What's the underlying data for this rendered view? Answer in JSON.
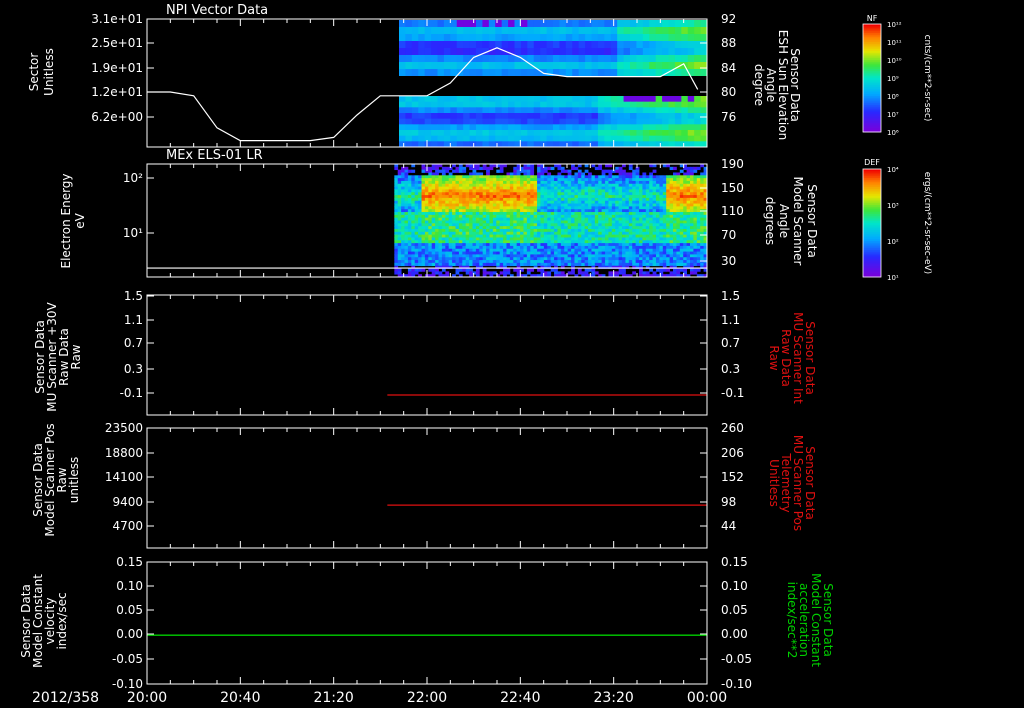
{
  "colors": {
    "background": "#000000",
    "axis": "#ffffff",
    "red_series": "#e01010",
    "green_series": "#00d000"
  },
  "header_panel_title": "NPI Vector Data",
  "footer": {
    "date": "2012/358"
  },
  "x_axis": {
    "ticks": [
      "20:00",
      "20:40",
      "21:20",
      "22:00",
      "22:40",
      "23:20",
      "00:00"
    ]
  },
  "colorbars": [
    {
      "title": "NF",
      "unit": "cnts/(cm**2-sr-sec)",
      "top_label": "10¹²",
      "bottom_label": "10⁶",
      "tick_labels": [
        "10¹²",
        "10¹¹",
        "10¹⁰",
        "10⁹",
        "10⁸",
        "10⁷",
        "10⁶"
      ]
    },
    {
      "title": "DEF",
      "unit": "ergs/(cm**2-sr-sec-eV)",
      "top_label": "10⁴",
      "bottom_label": "10¹",
      "tick_labels": [
        "10⁴",
        "10³",
        "10²",
        "10¹"
      ]
    }
  ],
  "chart_data": [
    {
      "type": "heatmap",
      "title": "NPI Vector Data",
      "ylabel": [
        "Sector",
        "Unitless"
      ],
      "ytick_labels": [
        "3.1e+01",
        "2.5e+01",
        "1.9e+01",
        "1.2e+01",
        "6.2e+00"
      ],
      "y2label": [
        "Sensor Data",
        "ESH Sun Elevation",
        "Angle",
        "degree"
      ],
      "y2tick_labels": [
        "92",
        "88",
        "84",
        "80",
        "76"
      ],
      "heatmap_start_time": "21:48",
      "line": {
        "y2lim": [
          72,
          92
        ],
        "x": [
          "20:00",
          "20:10",
          "20:20",
          "20:30",
          "20:40",
          "20:50",
          "21:00",
          "21:10",
          "21:20",
          "21:30",
          "21:40",
          "21:50",
          "22:00",
          "22:10",
          "22:20",
          "22:30",
          "22:40",
          "22:50",
          "23:00",
          "23:10",
          "23:20",
          "23:30",
          "23:40",
          "23:50",
          "23:56"
        ],
        "values": [
          80.6,
          80.6,
          80.0,
          75.0,
          73.0,
          73.0,
          73.0,
          73.0,
          73.5,
          77.0,
          80.0,
          80.0,
          80.0,
          82.0,
          86.0,
          87.5,
          86.0,
          83.5,
          83.0,
          83.0,
          83.0,
          83.0,
          83.0,
          85.0,
          81.0
        ]
      }
    },
    {
      "type": "heatmap",
      "title": "MEx ELS-01 LR",
      "ylabel": [
        "Electron Energy",
        "eV"
      ],
      "ytick_labels": [
        "10²",
        "10¹"
      ],
      "y2label": [
        "Sensor Data",
        "Model Scanner",
        "Angle",
        "degrees"
      ],
      "y2tick_labels": [
        "190",
        "150",
        "110",
        "70",
        "30"
      ],
      "heatmap_start_time": "21:46",
      "line": {
        "y2lim": [
          0,
          190
        ],
        "x": [
          "20:00",
          "00:00"
        ],
        "values": [
          15,
          15
        ]
      }
    },
    {
      "type": "line",
      "ylabel": [
        "Sensor Data",
        "MU Scanner +30V",
        "Raw Data",
        "Raw"
      ],
      "ytick_labels": [
        "1.5",
        "1.1",
        "0.7",
        "0.3",
        "-0.1"
      ],
      "ylim": [
        -0.3,
        1.5
      ],
      "y2label": [
        "Sensor Data",
        "MU Scanner Int",
        "Raw Data",
        "Raw"
      ],
      "y2tick_labels": [
        "1.5",
        "1.1",
        "0.7",
        "0.3",
        "-0.1"
      ],
      "series": [
        {
          "color": "#e01010",
          "x": [
            "21:43",
            "00:00"
          ],
          "values": [
            0.0,
            0.0
          ]
        }
      ]
    },
    {
      "type": "line",
      "ylabel": [
        "Sensor Data",
        "Model Scanner Pos",
        "Raw",
        "unitless"
      ],
      "ytick_labels": [
        "23500",
        "18800",
        "14100",
        "9400",
        "4700"
      ],
      "ylim": [
        0,
        23500
      ],
      "y2label": [
        "Sensor Data",
        "MU Scanner Pos",
        "Telemetry",
        "Unitless"
      ],
      "y2tick_labels": [
        "260",
        "206",
        "152",
        "98",
        "44"
      ],
      "series": [
        {
          "color": "#e01010",
          "x": [
            "21:43",
            "00:00"
          ],
          "values": [
            8400,
            8400
          ]
        }
      ]
    },
    {
      "type": "line",
      "ylabel": [
        "Sensor Data",
        "Model Constant",
        "velocity",
        "index/sec"
      ],
      "ytick_labels": [
        "0.15",
        "0.10",
        "0.05",
        "0.00",
        "-0.05",
        "-0.10"
      ],
      "ylim": [
        -0.1,
        0.15
      ],
      "y2label": [
        "Sensor Data",
        "Model Constant",
        "acceleration",
        "index/sec**2"
      ],
      "y2tick_labels": [
        "0.15",
        "0.10",
        "0.05",
        "0.00",
        "-0.05",
        "-0.10"
      ],
      "series": [
        {
          "color": "#00d000",
          "x": [
            "20:00",
            "00:00"
          ],
          "values": [
            0.0,
            0.0
          ]
        }
      ]
    }
  ]
}
